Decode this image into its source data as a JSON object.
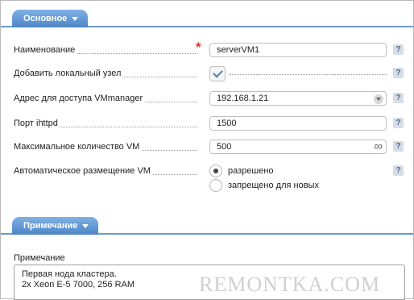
{
  "sections": {
    "main": {
      "title": "Основное"
    },
    "note": {
      "title": "Примечание"
    }
  },
  "fields": {
    "name": {
      "label": "Наименование",
      "value": "serverVM1",
      "required": true
    },
    "add_local_node": {
      "label": "Добавить локальный узел",
      "checked": true
    },
    "vmmanager_address": {
      "label": "Адрес для доступа VMmanager",
      "value": "192.168.1.21"
    },
    "ihttpd_port": {
      "label": "Порт ihttpd",
      "value": "1500"
    },
    "max_vm": {
      "label": "Максимальное количество VM",
      "value": "500"
    },
    "auto_placement": {
      "label": "Автоматическое размещение VM",
      "options": [
        "разрешено",
        "запрещено для новых"
      ],
      "selected": "разрешено"
    }
  },
  "note": {
    "label": "Примечание",
    "text": "Первая нода кластера.\n2x Xeon E-5 7000, 256 RAM"
  },
  "help_glyph": "?",
  "required_glyph": "*",
  "infinity_glyph": "∞",
  "watermark": "REMONTKA.COM",
  "colors": {
    "accent": "#4d86c6",
    "required": "#dd3333"
  }
}
